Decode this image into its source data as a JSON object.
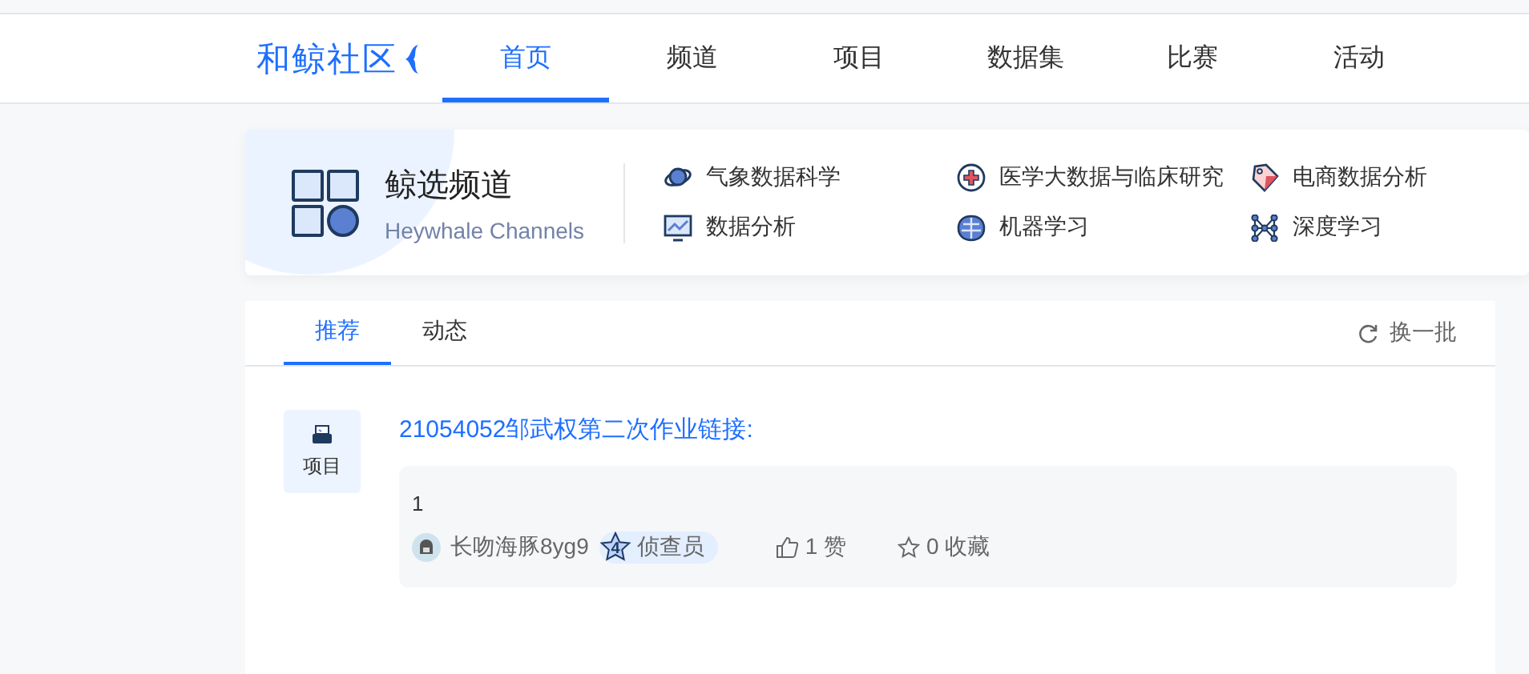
{
  "logo": "和鲸社区",
  "nav": [
    {
      "label": "首页",
      "selected": true
    },
    {
      "label": "频道",
      "selected": false
    },
    {
      "label": "项目",
      "selected": false
    },
    {
      "label": "数据集",
      "selected": false
    },
    {
      "label": "比赛",
      "selected": false
    },
    {
      "label": "活动",
      "selected": false
    }
  ],
  "channel_header": {
    "title": "鲸选频道",
    "subtitle": "Heywhale Channels"
  },
  "channels": [
    {
      "label": "气象数据科学"
    },
    {
      "label": "医学大数据与临床研究"
    },
    {
      "label": "电商数据分析"
    },
    {
      "label": "数据分析"
    },
    {
      "label": "机器学习"
    },
    {
      "label": "深度学习"
    }
  ],
  "feed_tabs": [
    {
      "label": "推荐",
      "selected": true
    },
    {
      "label": "动态",
      "selected": false
    }
  ],
  "refresh": "换一批",
  "posts": [
    {
      "type": "项目",
      "title": "21054052邹武权第二次作业链接:",
      "excerpt": "1",
      "author": "长吻海豚8yg9",
      "rank_number": "4",
      "rank_title": "侦查员",
      "likes": "1 赞",
      "favorites": "0 收藏"
    }
  ]
}
